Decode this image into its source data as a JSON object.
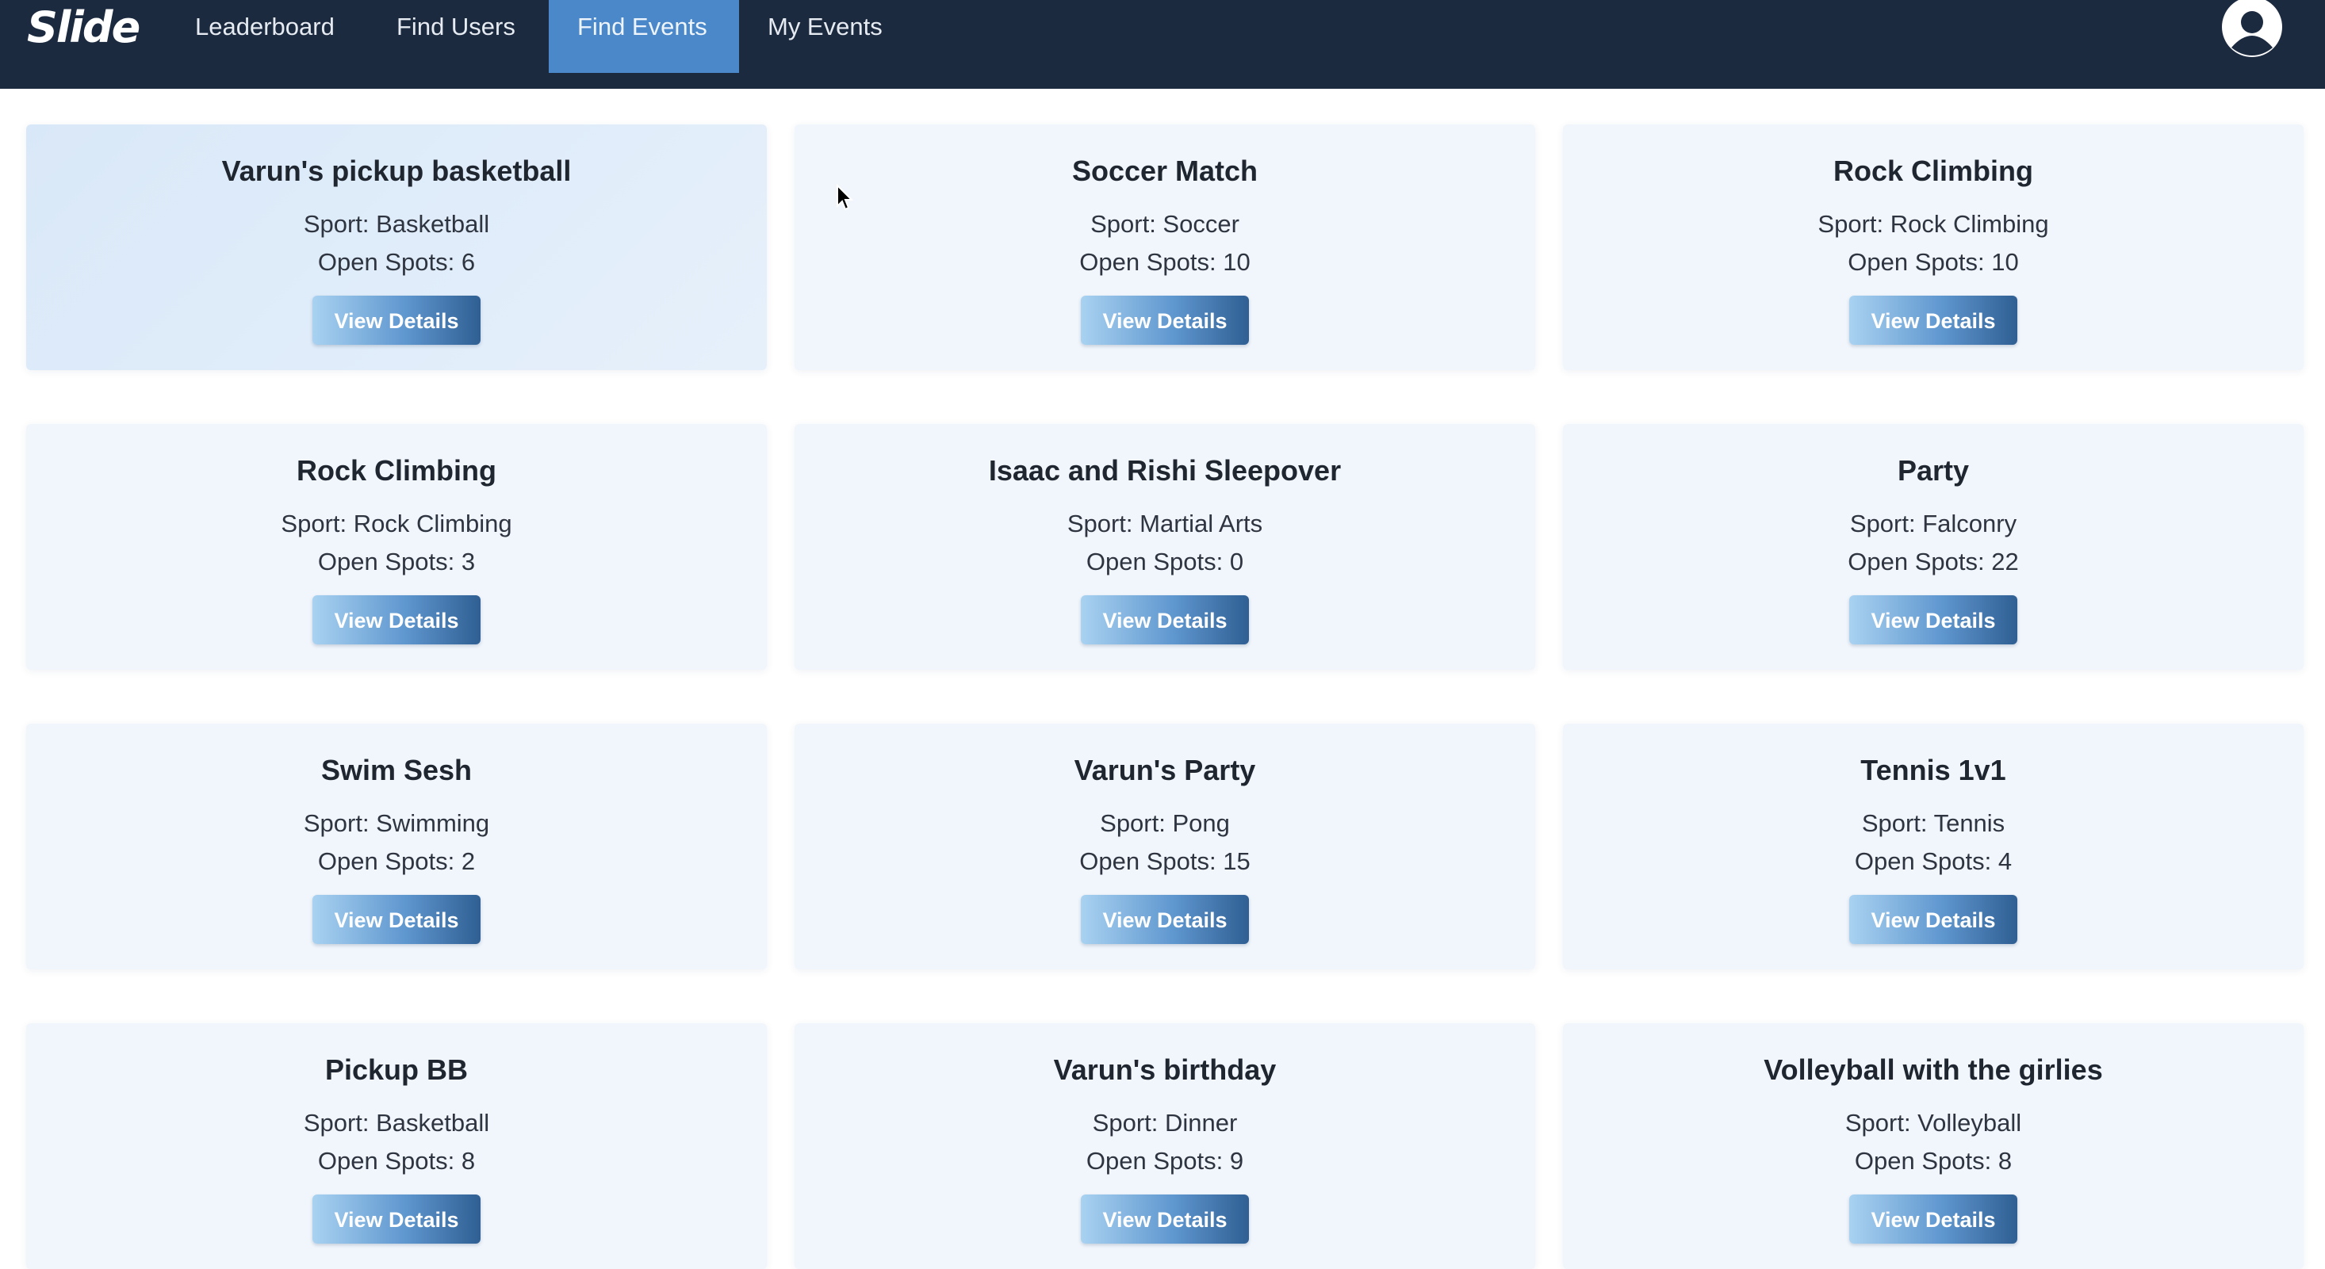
{
  "app": {
    "logo_text": "Slide"
  },
  "nav": {
    "items": [
      {
        "label": "Leaderboard",
        "active": false
      },
      {
        "label": "Find Users",
        "active": false
      },
      {
        "label": "Find Events",
        "active": true
      },
      {
        "label": "My Events",
        "active": false
      }
    ],
    "profile_icon": "user-avatar-icon"
  },
  "events": [
    {
      "title": "Varun's pickup basketball",
      "sport": "Sport: Basketball",
      "spots": "Open Spots: 6",
      "button": "View Details"
    },
    {
      "title": "Soccer Match",
      "sport": "Sport: Soccer",
      "spots": "Open Spots: 10",
      "button": "View Details"
    },
    {
      "title": "Rock Climbing",
      "sport": "Sport: Rock Climbing",
      "spots": "Open Spots: 10",
      "button": "View Details"
    },
    {
      "title": "Rock Climbing",
      "sport": "Sport: Rock Climbing",
      "spots": "Open Spots: 3",
      "button": "View Details"
    },
    {
      "title": "Isaac and Rishi Sleepover",
      "sport": "Sport: Martial Arts",
      "spots": "Open Spots: 0",
      "button": "View Details"
    },
    {
      "title": "Party",
      "sport": "Sport: Falconry",
      "spots": "Open Spots: 22",
      "button": "View Details"
    },
    {
      "title": "Swim Sesh",
      "sport": "Sport: Swimming",
      "spots": "Open Spots: 2",
      "button": "View Details"
    },
    {
      "title": "Varun's Party",
      "sport": "Sport: Pong",
      "spots": "Open Spots: 15",
      "button": "View Details"
    },
    {
      "title": "Tennis 1v1",
      "sport": "Sport: Tennis",
      "spots": "Open Spots: 4",
      "button": "View Details"
    },
    {
      "title": "Pickup BB",
      "sport": "Sport: Basketball",
      "spots": "Open Spots: 8",
      "button": "View Details"
    },
    {
      "title": "Varun's birthday",
      "sport": "Sport: Dinner",
      "spots": "Open Spots: 9",
      "button": "View Details"
    },
    {
      "title": "Volleyball with the girlies",
      "sport": "Sport: Volleyball",
      "spots": "Open Spots: 8",
      "button": "View Details"
    }
  ],
  "colors": {
    "navbar_bg": "#1c2a40",
    "nav_active_bg": "#4a88c9",
    "card_bg": "#f1f6fc",
    "button_gradient_start": "#a9d2f1",
    "button_gradient_end": "#2f5f93"
  }
}
